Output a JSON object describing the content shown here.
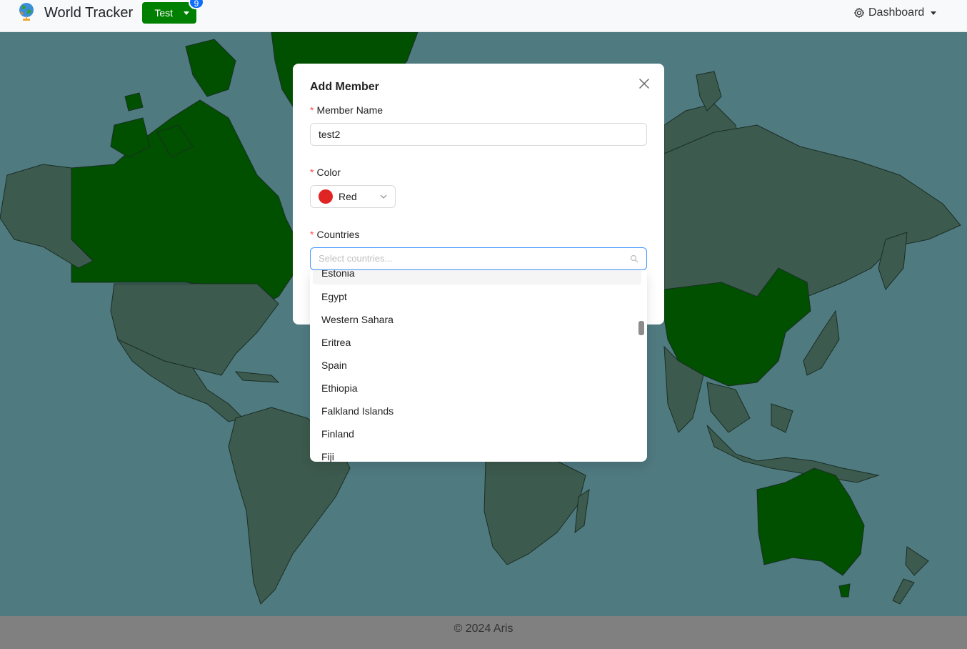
{
  "navbar": {
    "brand": "World Tracker",
    "group_button": "Test",
    "badge_count": "9",
    "dashboard_label": "Dashboard"
  },
  "modal": {
    "title": "Add Member",
    "member_name_label": "Member Name",
    "member_name_value": "test2",
    "color_label": "Color",
    "color_value": "Red",
    "color_hex": "#e02424",
    "countries_label": "Countries",
    "countries_placeholder": "Select countries..."
  },
  "dropdown": {
    "options": [
      "Estonia",
      "Egypt",
      "Western Sahara",
      "Eritrea",
      "Spain",
      "Ethiopia",
      "Falkland Islands",
      "Finland",
      "Fiji"
    ]
  },
  "footer": {
    "text": "© 2024 Aris"
  },
  "colors": {
    "ocean": "#4f7a80",
    "land": "#3d5a4e",
    "visited": "#005000",
    "accent": "#008000"
  }
}
